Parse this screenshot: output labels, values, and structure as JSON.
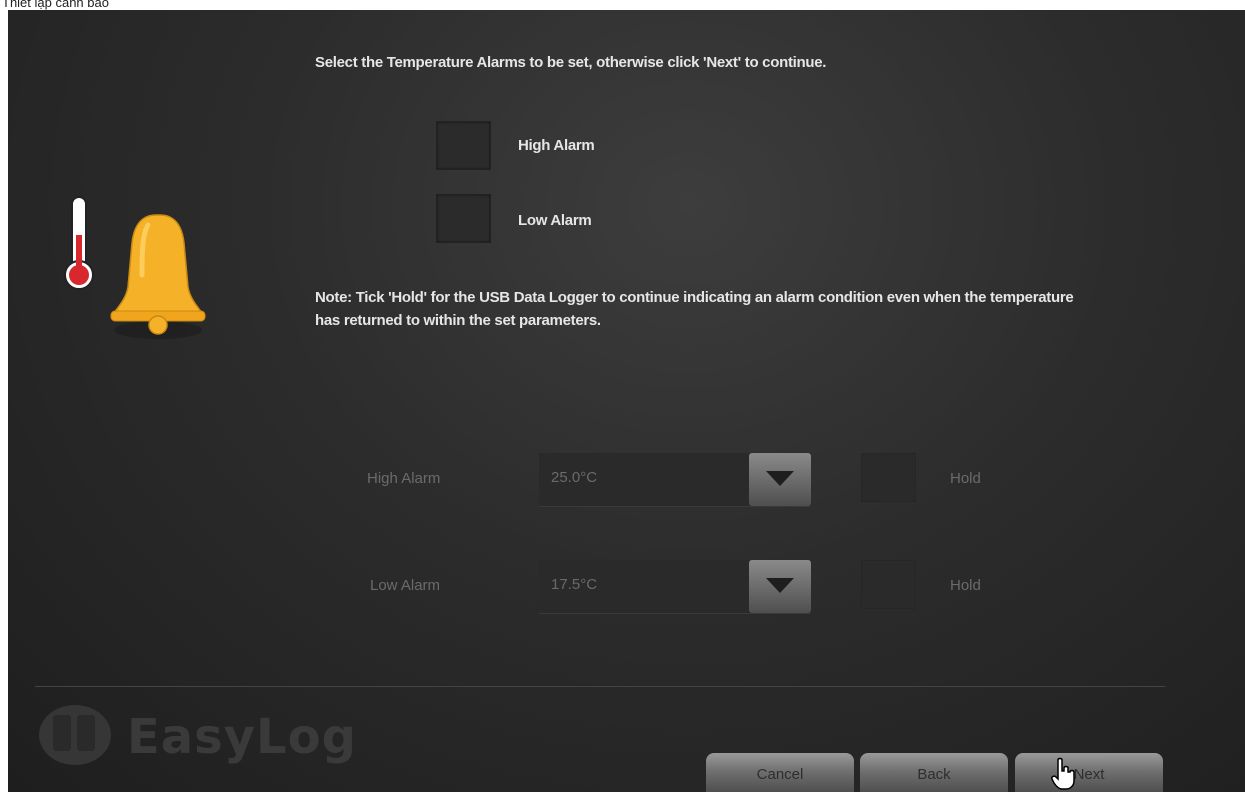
{
  "caption": "Thiết lập cảnh báo",
  "intro": "Select the Temperature Alarms to be set, otherwise click 'Next' to continue.",
  "alarm_options": [
    {
      "label": "High Alarm",
      "checked": false
    },
    {
      "label": "Low Alarm",
      "checked": false
    }
  ],
  "note": "Note: Tick 'Hold' for the USB Data Logger to continue indicating an alarm condition even when the temperature has returned to within the set parameters.",
  "settings": [
    {
      "label": "High Alarm",
      "value": "25.0°C",
      "hold_label": "Hold",
      "enabled": false
    },
    {
      "label": "Low Alarm",
      "value": "17.5°C",
      "hold_label": "Hold",
      "enabled": false
    }
  ],
  "logo": {
    "text": "EasyLog"
  },
  "buttons": {
    "cancel": "Cancel",
    "back": "Back",
    "next": "Next"
  },
  "icons": {
    "illustration": "thermometer-bell-icon",
    "logo": "easylog-logo-icon",
    "dropdown": "chevron-down-icon",
    "cursor": "hand-pointer-icon"
  },
  "colors": {
    "bell": "#f5b128",
    "thermometer": "#d9272e",
    "panel": "#2c2c2c"
  }
}
